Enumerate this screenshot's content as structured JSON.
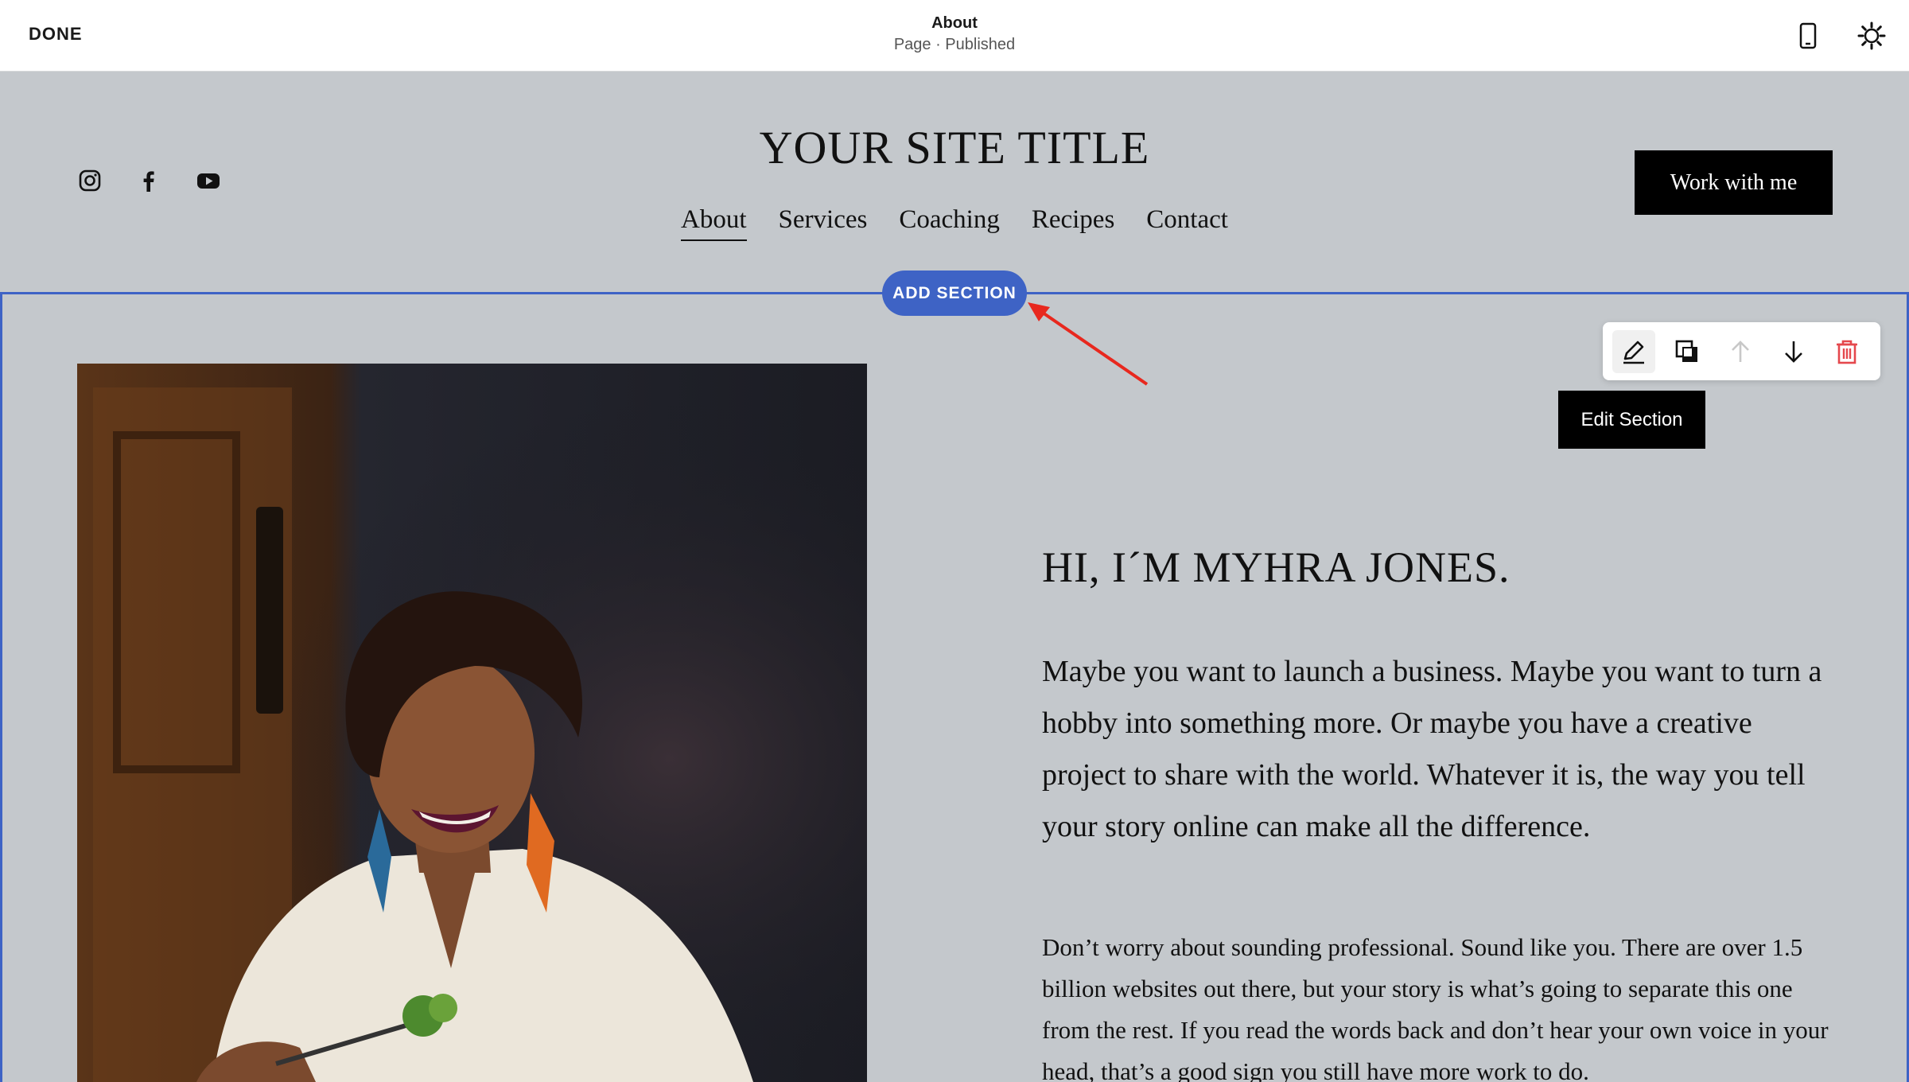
{
  "topbar": {
    "done_label": "DONE",
    "page_name": "About",
    "page_status": "Page · Published",
    "icons": [
      "mobile-preview-icon",
      "settings-icon"
    ]
  },
  "header": {
    "site_title": "YOUR SITE TITLE",
    "social_icons": [
      "instagram-icon",
      "facebook-icon",
      "youtube-icon"
    ],
    "nav": [
      "About",
      "Services",
      "Coaching",
      "Recipes",
      "Contact"
    ],
    "active_nav": "About",
    "cta_label": "Work with me"
  },
  "section": {
    "add_section_label": "ADD SECTION",
    "toolbar_icons": [
      "edit-icon",
      "duplicate-icon",
      "move-up-icon",
      "move-down-icon",
      "delete-icon"
    ],
    "tooltip": "Edit Section",
    "heading": "HI, I´M MYHRA JONES.",
    "paragraph1": "Maybe you want to launch a business. Maybe you want to turn a hobby into something more. Or maybe you have a creative project to share with the world. Whatever it is, the way you tell your story online can make all the difference.",
    "paragraph2": "Don’t worry about sounding professional. Sound like you. There are over 1.5 billion websites out there, but your story is what’s going to separate this one from the rest. If you read the words back and don’t hear your own voice in your head, that’s a good sign you still have more work to do."
  },
  "colors": {
    "accent": "#3e63c5",
    "background": "#c4c8cc",
    "annotation_arrow": "#e8281e",
    "delete": "#e5484d"
  }
}
